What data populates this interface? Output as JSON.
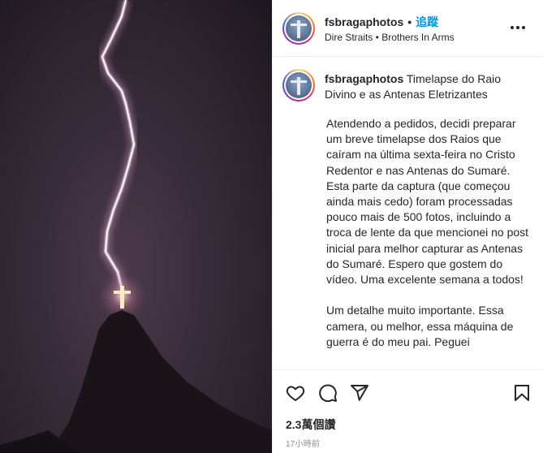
{
  "header": {
    "username": "fsbragaphotos",
    "separator": "•",
    "follow_label": "追蹤",
    "song": "Dire Straits • Brothers In Arms"
  },
  "caption": {
    "username": "fsbragaphotos",
    "title": "Timelapse do Raio Divino e as Antenas Eletrizantes",
    "body": "Atendendo a pedidos, decidi preparar um breve timelapse dos Raios que caíram na última sexta-feira no Cristo Redentor e nas Antenas do Sumaré. Esta parte da captura (que começou ainda mais cedo) foram processadas pouco mais de 500 fotos, incluindo a troca de lente da que mencionei no post inicial para melhor capturar as Antenas do Sumaré. Espero que gostem do vídeo. Uma excelente semana a todos!\n\nUm detalhe muito importante. Essa camera, ou melhor, essa máquina de guerra é do meu pai. Peguei"
  },
  "stats": {
    "views": "2.3萬個讚",
    "time_ago": "17小時前"
  },
  "icons": {
    "like": "heart-icon",
    "comment": "comment-icon",
    "share": "paper-plane-icon",
    "save": "bookmark-icon",
    "more": "more-horizontal-icon"
  }
}
